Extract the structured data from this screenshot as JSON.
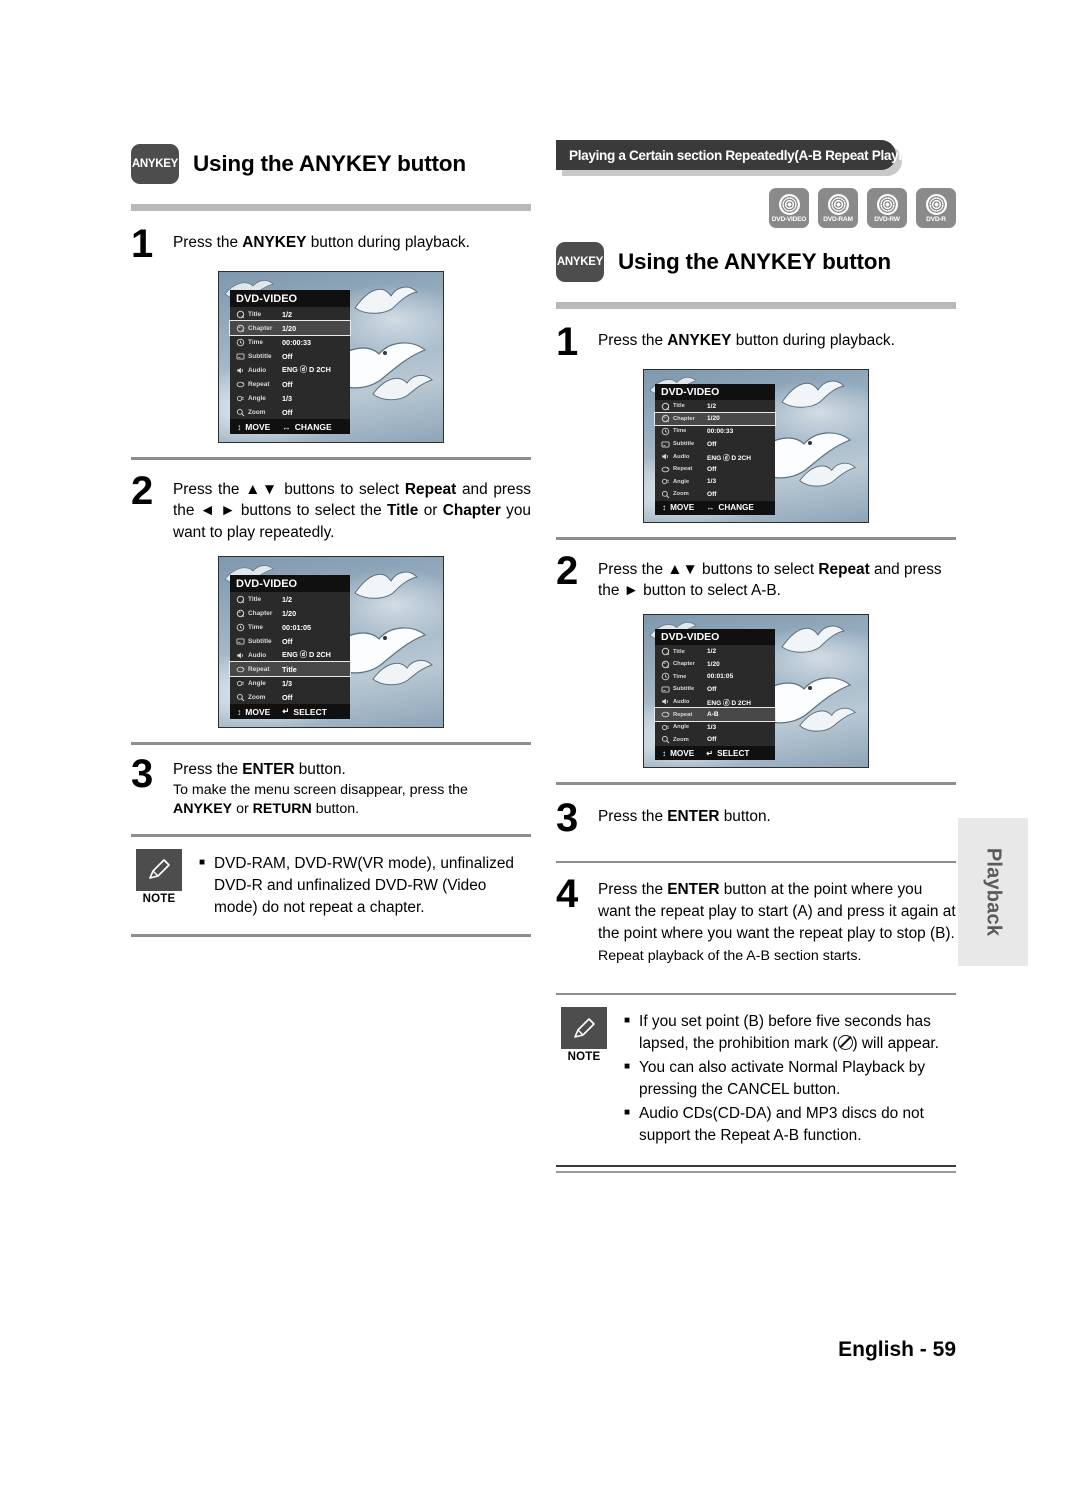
{
  "document": {
    "footer_language": "English",
    "footer_separator": "-",
    "footer_page": "59",
    "side_tab": "Playback"
  },
  "left_column": {
    "chip_label": "ANYKEY",
    "heading": "Using the ANYKEY button",
    "steps": [
      {
        "number": "1",
        "text_parts": [
          {
            "t": "Press the ",
            "b": false
          },
          {
            "t": "ANYKEY",
            "b": true
          },
          {
            "t": " button during playback.",
            "b": false
          }
        ]
      },
      {
        "number": "2",
        "text_parts": [
          {
            "t": "Press the ",
            "b": false
          },
          {
            "t": "▲▼",
            "b": true
          },
          {
            "t": " buttons to select ",
            "b": false
          },
          {
            "t": "Repeat",
            "b": true
          },
          {
            "t": " and press the ",
            "b": false
          },
          {
            "t": "◄ ►",
            "b": true
          },
          {
            "t": " buttons to select the ",
            "b": false
          },
          {
            "t": "Title",
            "b": true
          },
          {
            "t": " or ",
            "b": false
          },
          {
            "t": "Chapter",
            "b": true
          },
          {
            "t": " you want to play repeatedly.",
            "b": false
          }
        ]
      },
      {
        "number": "3",
        "text_parts": [
          {
            "t": "Press the ",
            "b": false
          },
          {
            "t": "ENTER",
            "b": true
          },
          {
            "t": " button.",
            "b": false
          }
        ],
        "sub_parts": [
          {
            "t": "To make the menu screen disappear, press the ",
            "b": false
          },
          {
            "t": "ANYKEY",
            "b": true
          },
          {
            "t": " or ",
            "b": false
          },
          {
            "t": "RETURN",
            "b": true
          },
          {
            "t": " button.",
            "b": false
          }
        ]
      }
    ],
    "note": {
      "label": "NOTE",
      "items": [
        "DVD-RAM, DVD-RW(VR mode), unfinalized DVD-R and unfinalized DVD-RW (Video mode) do not repeat a chapter."
      ]
    },
    "osd_1": {
      "title": "DVD-VIDEO",
      "rows": [
        {
          "icon": "title-icon",
          "label": "Title",
          "value": "1/2",
          "highlighted": false
        },
        {
          "icon": "chapter-icon",
          "label": "Chapter",
          "value": "1/20",
          "highlighted": true
        },
        {
          "icon": "time-icon",
          "label": "Time",
          "value": "00:00:33",
          "highlighted": false
        },
        {
          "icon": "subtitle-icon",
          "label": "Subtitle",
          "value": "Off",
          "highlighted": false
        },
        {
          "icon": "audio-icon",
          "label": "Audio",
          "value": "ENG ⓓ D 2CH",
          "highlighted": false
        },
        {
          "icon": "repeat-icon",
          "label": "Repeat",
          "value": "Off",
          "highlighted": false
        },
        {
          "icon": "angle-icon",
          "label": "Angle",
          "value": "1/3",
          "highlighted": false
        },
        {
          "icon": "zoom-icon",
          "label": "Zoom",
          "value": "Off",
          "highlighted": false
        }
      ],
      "footer_move": "MOVE",
      "footer_action": "CHANGE",
      "footer_move_glyph": "↕",
      "footer_action_glyph": "↔"
    },
    "osd_2": {
      "title": "DVD-VIDEO",
      "rows": [
        {
          "icon": "title-icon",
          "label": "Title",
          "value": "1/2",
          "highlighted": false
        },
        {
          "icon": "chapter-icon",
          "label": "Chapter",
          "value": "1/20",
          "highlighted": false
        },
        {
          "icon": "time-icon",
          "label": "Time",
          "value": "00:01:05",
          "highlighted": false
        },
        {
          "icon": "subtitle-icon",
          "label": "Subtitle",
          "value": "Off",
          "highlighted": false
        },
        {
          "icon": "audio-icon",
          "label": "Audio",
          "value": "ENG ⓓ D 2CH",
          "highlighted": false
        },
        {
          "icon": "repeat-icon",
          "label": "Repeat",
          "value": "Title",
          "highlighted": true
        },
        {
          "icon": "angle-icon",
          "label": "Angle",
          "value": "1/3",
          "highlighted": false
        },
        {
          "icon": "zoom-icon",
          "label": "Zoom",
          "value": "Off",
          "highlighted": false
        }
      ],
      "footer_move": "MOVE",
      "footer_action": "SELECT",
      "footer_move_glyph": "↕",
      "footer_action_glyph": "↵"
    }
  },
  "right_column": {
    "banner": "Playing a Certain section Repeatedly(A-B Repeat Playback)",
    "discs": [
      {
        "name": "DVD-VIDEO"
      },
      {
        "name": "DVD-RAM"
      },
      {
        "name": "DVD-RW"
      },
      {
        "name": "DVD-R"
      }
    ],
    "chip_label": "ANYKEY",
    "heading": "Using the ANYKEY button",
    "steps": [
      {
        "number": "1",
        "text_parts": [
          {
            "t": "Press the ",
            "b": false
          },
          {
            "t": "ANYKEY",
            "b": true
          },
          {
            "t": " button during playback.",
            "b": false
          }
        ]
      },
      {
        "number": "2",
        "text_parts": [
          {
            "t": "Press the ",
            "b": false
          },
          {
            "t": "▲▼",
            "b": true
          },
          {
            "t": " buttons to select ",
            "b": false
          },
          {
            "t": "Repeat",
            "b": true
          },
          {
            "t": " and press the ",
            "b": false
          },
          {
            "t": "►",
            "b": true
          },
          {
            "t": " button to select A-B.",
            "b": false
          }
        ]
      },
      {
        "number": "3",
        "text_parts": [
          {
            "t": "Press the ",
            "b": false
          },
          {
            "t": "ENTER",
            "b": true
          },
          {
            "t": " button.",
            "b": false
          }
        ]
      },
      {
        "number": "4",
        "text_parts": [
          {
            "t": "Press the ",
            "b": false
          },
          {
            "t": "ENTER",
            "b": true
          },
          {
            "t": " button at the point where you want the repeat play to start (A) and press it again at the point where you want the repeat play to stop (B).",
            "b": false
          }
        ],
        "sub_parts": [
          {
            "t": "Repeat playback of the A-B section starts.",
            "b": false
          }
        ]
      }
    ],
    "note": {
      "label": "NOTE",
      "items": [
        {
          "before": "If you set point (B) before five seconds has lapsed, the prohibition mark (",
          "glyph": "prohibition-mark",
          "after": ") will appear."
        },
        {
          "before": "You can also activate Normal Playback by pressing the CANCEL button.",
          "glyph": null,
          "after": ""
        },
        {
          "before": "Audio CDs(CD-DA) and MP3 discs do not support the Repeat A-B function.",
          "glyph": null,
          "after": ""
        }
      ]
    },
    "osd_1": {
      "title": "DVD-VIDEO",
      "rows": [
        {
          "icon": "title-icon",
          "label": "Title",
          "value": "1/2",
          "highlighted": false
        },
        {
          "icon": "chapter-icon",
          "label": "Chapter",
          "value": "1/20",
          "highlighted": true
        },
        {
          "icon": "time-icon",
          "label": "Time",
          "value": "00:00:33",
          "highlighted": false
        },
        {
          "icon": "subtitle-icon",
          "label": "Subtitle",
          "value": "Off",
          "highlighted": false
        },
        {
          "icon": "audio-icon",
          "label": "Audio",
          "value": "ENG ⓓ D 2CH",
          "highlighted": false
        },
        {
          "icon": "repeat-icon",
          "label": "Repeat",
          "value": "Off",
          "highlighted": false
        },
        {
          "icon": "angle-icon",
          "label": "Angle",
          "value": "1/3",
          "highlighted": false
        },
        {
          "icon": "zoom-icon",
          "label": "Zoom",
          "value": "Off",
          "highlighted": false
        }
      ],
      "footer_move": "MOVE",
      "footer_action": "CHANGE",
      "footer_move_glyph": "↕",
      "footer_action_glyph": "↔"
    },
    "osd_2": {
      "title": "DVD-VIDEO",
      "rows": [
        {
          "icon": "title-icon",
          "label": "Title",
          "value": "1/2",
          "highlighted": false
        },
        {
          "icon": "chapter-icon",
          "label": "Chapter",
          "value": "1/20",
          "highlighted": false
        },
        {
          "icon": "time-icon",
          "label": "Time",
          "value": "00:01:05",
          "highlighted": false
        },
        {
          "icon": "subtitle-icon",
          "label": "Subtitle",
          "value": "Off",
          "highlighted": false
        },
        {
          "icon": "audio-icon",
          "label": "Audio",
          "value": "ENG ⓓ D 2CH",
          "highlighted": false
        },
        {
          "icon": "repeat-icon",
          "label": "Repeat",
          "value": "A-B",
          "highlighted": true
        },
        {
          "icon": "angle-icon",
          "label": "Angle",
          "value": "1/3",
          "highlighted": false
        },
        {
          "icon": "zoom-icon",
          "label": "Zoom",
          "value": "Off",
          "highlighted": false
        }
      ],
      "footer_move": "MOVE",
      "footer_action": "SELECT",
      "footer_move_glyph": "↕",
      "footer_action_glyph": "↵"
    }
  },
  "colors": {
    "chip_gray": "#4d4d4d",
    "rule_gray": "#b9b9b9",
    "banner_dark": "#3a3a3a",
    "disc_gray": "#8a8a8a",
    "side_tab_bg": "#e8e8e8"
  }
}
